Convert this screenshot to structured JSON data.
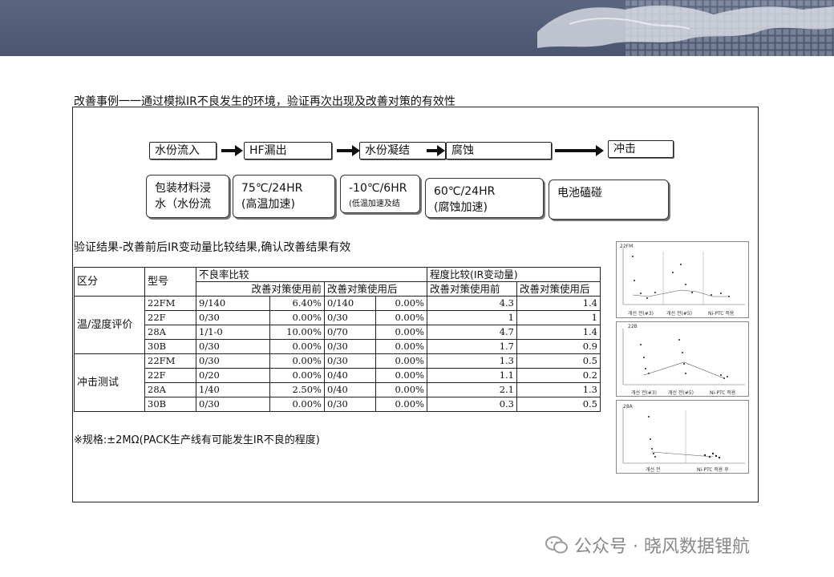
{
  "header": {
    "bg_color": "#4f5a74"
  },
  "title": "改善事例一一通过模拟IR不良发生的环境，验证再次出现及改善对策的有效性",
  "flow": {
    "steps": [
      "水份流入",
      "HF漏出",
      "水份凝结",
      "腐蚀",
      "冲击"
    ],
    "conditions": [
      {
        "line1": "包装材料浸",
        "line2": "水（水份流"
      },
      {
        "line1": "75℃/24HR",
        "line2": "(高温加速)"
      },
      {
        "line1": "-10℃/6HR",
        "line2": "(低温加速及结"
      },
      {
        "line1": "60℃/24HR",
        "line2": "(腐蚀加速)"
      },
      {
        "line1": "电池磕碰",
        "line2": ""
      }
    ]
  },
  "result_title": "验证结果-改善前后IR变动量比较结果,确认改善结果有效",
  "table": {
    "col_category": "区分",
    "col_model": "型号",
    "group_defect": "不良率比较",
    "group_degree": "程度比较(IR变动量)",
    "sub_before": "改善对策使用前",
    "sub_after": "改善对策使用后",
    "sub_before2": "改善对策使用前",
    "sub_after2": "改善对策使用后",
    "cat1": "温/湿度评价",
    "cat2": "冲击测试",
    "rows": [
      {
        "model": "22FM",
        "b_cnt": "9/140",
        "b_pct": "6.40%",
        "a_cnt": "0/140",
        "a_pct": "0.00%",
        "d_before": "4.3",
        "d_after": "1.4"
      },
      {
        "model": "22F",
        "b_cnt": "0/30",
        "b_pct": "0.00%",
        "a_cnt": "0/30",
        "a_pct": "0.00%",
        "d_before": "1",
        "d_after": "1"
      },
      {
        "model": "28A",
        "b_cnt": "1/1-0",
        "b_pct": "10.00%",
        "a_cnt": "0/70",
        "a_pct": "0.00%",
        "d_before": "4.7",
        "d_after": "1.4"
      },
      {
        "model": "30B",
        "b_cnt": "0/30",
        "b_pct": "0.00%",
        "a_cnt": "0/30",
        "a_pct": "0.00%",
        "d_before": "1.7",
        "d_after": "0.9"
      },
      {
        "model": "22FM",
        "b_cnt": "0/30",
        "b_pct": "0.00%",
        "a_cnt": "0/30",
        "a_pct": "0.00%",
        "d_before": "1.3",
        "d_after": "0.5"
      },
      {
        "model": "22F",
        "b_cnt": "0/20",
        "b_pct": "0.00%",
        "a_cnt": "0/40",
        "a_pct": "0.00%",
        "d_before": "1.1",
        "d_after": "0.2"
      },
      {
        "model": "28A",
        "b_cnt": "1/40",
        "b_pct": "2.50%",
        "a_cnt": "0/40",
        "a_pct": "0.00%",
        "d_before": "2.1",
        "d_after": "1.3"
      },
      {
        "model": "30B",
        "b_cnt": "0/30",
        "b_pct": "0.00%",
        "a_cnt": "0/30",
        "a_pct": "0.00%",
        "d_before": "0.3",
        "d_after": "0.5"
      }
    ]
  },
  "note": "※规格:±2MΩ(PACK生产线有可能发生IR不良的程度)",
  "charts": [
    {
      "tag": "22FM",
      "labels": [
        "개선 전(#3)",
        "개선 전(#5)",
        "Ni-PTC 적용"
      ]
    },
    {
      "tag": "22B",
      "labels": [
        "개선 전(#3)",
        "개선 전(#5)",
        "Ni-PTC 적용"
      ]
    },
    {
      "tag": "28A",
      "labels": [
        "개선 전",
        "Ni-PTC 적용 후"
      ]
    }
  ],
  "watermark": "公众号 · 晓风数据锂航"
}
